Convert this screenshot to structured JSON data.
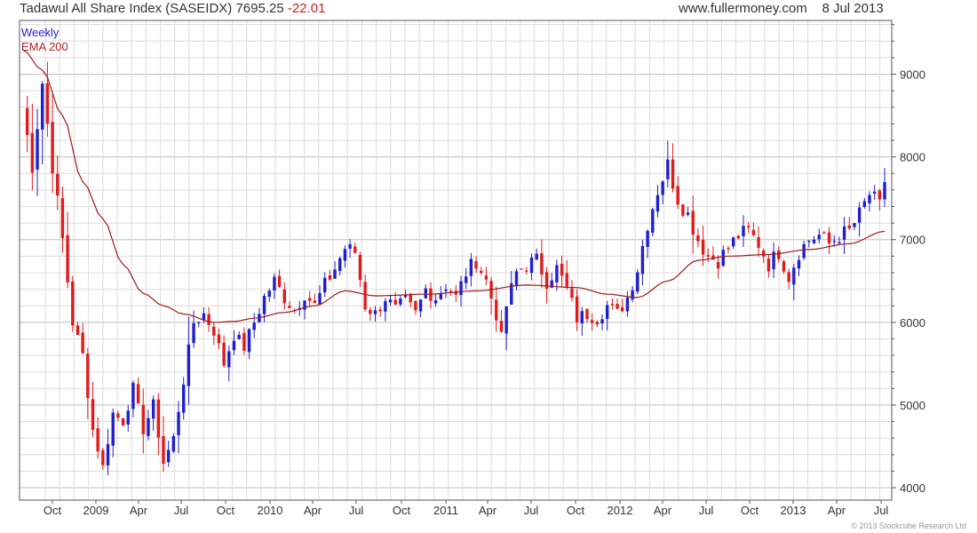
{
  "header": {
    "symbol_label": "Tadawul All Share Index (SASEIDX)",
    "last_price": "7695.25",
    "change": "-22.01",
    "website": "www.fullermoney.com",
    "date": "8 Jul 2013"
  },
  "legend": {
    "period": "Weekly",
    "indicator": "EMA 200"
  },
  "credit": "© 2013 Stockcube Research Ltd",
  "colors": {
    "up": "#1f1fcf",
    "down": "#e41a1a",
    "ema": "#a01818",
    "grid": "#dcdcdc"
  },
  "chart_data": {
    "type": "candlestick",
    "y_axis": {
      "side": "right",
      "ylim": [
        3850,
        9650
      ],
      "ticks": [
        4000,
        5000,
        6000,
        7000,
        8000,
        9000
      ]
    },
    "x_axis": {
      "labels": [
        "Oct",
        "2009",
        "Apr",
        "Jul",
        "Oct",
        "2010",
        "Apr",
        "Jul",
        "Oct",
        "2011",
        "Apr",
        "Jul",
        "Oct",
        "2012",
        "Apr",
        "Jul",
        "Oct",
        "2013",
        "Apr",
        "Jul"
      ]
    },
    "grid": true,
    "anchors": [
      {
        "week": 0,
        "close": 8600
      },
      {
        "week": 2,
        "close": 7900
      },
      {
        "week": 4,
        "close": 8900
      },
      {
        "week": 6,
        "close": 7900
      },
      {
        "week": 8,
        "close": 7000
      },
      {
        "week": 10,
        "close": 6000
      },
      {
        "week": 12,
        "close": 5600
      },
      {
        "week": 14,
        "close": 4700
      },
      {
        "week": 16,
        "close": 4250
      },
      {
        "week": 18,
        "close": 4900
      },
      {
        "week": 20,
        "close": 4800
      },
      {
        "week": 22,
        "close": 5200
      },
      {
        "week": 24,
        "close": 4700
      },
      {
        "week": 26,
        "close": 5000
      },
      {
        "week": 28,
        "close": 4300
      },
      {
        "week": 30,
        "close": 4600
      },
      {
        "week": 32,
        "close": 5300
      },
      {
        "week": 34,
        "close": 6000
      },
      {
        "week": 36,
        "close": 6100
      },
      {
        "week": 38,
        "close": 5900
      },
      {
        "week": 40,
        "close": 5500
      },
      {
        "week": 42,
        "close": 5850
      },
      {
        "week": 44,
        "close": 5700
      },
      {
        "week": 46,
        "close": 6000
      },
      {
        "week": 48,
        "close": 6300
      },
      {
        "week": 50,
        "close": 6500
      },
      {
        "week": 52,
        "close": 6300
      },
      {
        "week": 54,
        "close": 6150
      },
      {
        "week": 56,
        "close": 6350
      },
      {
        "week": 58,
        "close": 6200
      },
      {
        "week": 60,
        "close": 6450
      },
      {
        "week": 62,
        "close": 6650
      },
      {
        "week": 64,
        "close": 6900
      },
      {
        "week": 66,
        "close": 6850
      },
      {
        "week": 68,
        "close": 6200
      },
      {
        "week": 70,
        "close": 6100
      },
      {
        "week": 72,
        "close": 6300
      },
      {
        "week": 74,
        "close": 6150
      },
      {
        "week": 76,
        "close": 6250
      },
      {
        "week": 78,
        "close": 6100
      },
      {
        "week": 80,
        "close": 6400
      },
      {
        "week": 82,
        "close": 6300
      },
      {
        "week": 84,
        "close": 6450
      },
      {
        "week": 86,
        "close": 6300
      },
      {
        "week": 88,
        "close": 6600
      },
      {
        "week": 90,
        "close": 6750
      },
      {
        "week": 92,
        "close": 6500
      },
      {
        "week": 94,
        "close": 6100
      },
      {
        "week": 95,
        "close": 5800
      },
      {
        "week": 96,
        "close": 6200
      },
      {
        "week": 98,
        "close": 6600
      },
      {
        "week": 100,
        "close": 6700
      },
      {
        "week": 102,
        "close": 6750
      },
      {
        "week": 104,
        "close": 6500
      },
      {
        "week": 106,
        "close": 6650
      },
      {
        "week": 108,
        "close": 6400
      },
      {
        "week": 110,
        "close": 6050
      },
      {
        "week": 112,
        "close": 6100
      },
      {
        "week": 114,
        "close": 6050
      },
      {
        "week": 116,
        "close": 6200
      },
      {
        "week": 118,
        "close": 6100
      },
      {
        "week": 120,
        "close": 6300
      },
      {
        "week": 122,
        "close": 6650
      },
      {
        "week": 124,
        "close": 7200
      },
      {
        "week": 126,
        "close": 7600
      },
      {
        "week": 128,
        "close": 7900
      },
      {
        "week": 130,
        "close": 7500
      },
      {
        "week": 132,
        "close": 7300
      },
      {
        "week": 134,
        "close": 7000
      },
      {
        "week": 136,
        "close": 6800
      },
      {
        "week": 138,
        "close": 6750
      },
      {
        "week": 140,
        "close": 6900
      },
      {
        "week": 142,
        "close": 7050
      },
      {
        "week": 144,
        "close": 7100
      },
      {
        "week": 146,
        "close": 6950
      },
      {
        "week": 148,
        "close": 6700
      },
      {
        "week": 150,
        "close": 6850
      },
      {
        "week": 152,
        "close": 6550
      },
      {
        "week": 154,
        "close": 6850
      },
      {
        "week": 156,
        "close": 7000
      },
      {
        "week": 158,
        "close": 7050
      },
      {
        "week": 160,
        "close": 6950
      },
      {
        "week": 162,
        "close": 7050
      },
      {
        "week": 164,
        "close": 7100
      },
      {
        "week": 166,
        "close": 7300
      },
      {
        "week": 168,
        "close": 7550
      },
      {
        "week": 170,
        "close": 7400
      },
      {
        "week": 171,
        "close": 7695.25
      }
    ],
    "ema_200": [
      {
        "week": 0,
        "value": 9300
      },
      {
        "week": 4,
        "value": 9050
      },
      {
        "week": 8,
        "value": 8500
      },
      {
        "week": 12,
        "value": 7700
      },
      {
        "week": 16,
        "value": 7250
      },
      {
        "week": 20,
        "value": 6700
      },
      {
        "week": 24,
        "value": 6350
      },
      {
        "week": 28,
        "value": 6200
      },
      {
        "week": 32,
        "value": 6100
      },
      {
        "week": 38,
        "value": 6000
      },
      {
        "week": 42,
        "value": 6010
      },
      {
        "week": 46,
        "value": 6050
      },
      {
        "week": 52,
        "value": 6120
      },
      {
        "week": 58,
        "value": 6200
      },
      {
        "week": 64,
        "value": 6380
      },
      {
        "week": 70,
        "value": 6320
      },
      {
        "week": 80,
        "value": 6340
      },
      {
        "week": 90,
        "value": 6380
      },
      {
        "week": 100,
        "value": 6450
      },
      {
        "week": 110,
        "value": 6420
      },
      {
        "week": 116,
        "value": 6340
      },
      {
        "week": 122,
        "value": 6300
      },
      {
        "week": 128,
        "value": 6500
      },
      {
        "week": 134,
        "value": 6750
      },
      {
        "week": 140,
        "value": 6800
      },
      {
        "week": 148,
        "value": 6820
      },
      {
        "week": 156,
        "value": 6880
      },
      {
        "week": 164,
        "value": 6950
      },
      {
        "week": 171,
        "value": 7100
      }
    ]
  }
}
